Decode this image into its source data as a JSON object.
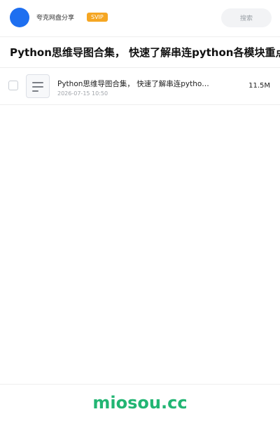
{
  "header": {
    "username": "夸克网盘分享",
    "badge": "SVIP",
    "search_label": "搜索"
  },
  "page": {
    "title": "Python思维导图合集， 快速了解串连python各模块重点·"
  },
  "files": [
    {
      "name": "Python思维导图合集， 快速了解串连pytho…",
      "date": "2026-07-15 10:50",
      "size": "11.5M"
    }
  ],
  "footer": {
    "brand": "miosou.cc"
  },
  "colors": {
    "accent": "#1e6ff0",
    "badge": "#f5a623",
    "brand": "#22b573"
  },
  "icons": {
    "file": "document-lines-icon"
  }
}
